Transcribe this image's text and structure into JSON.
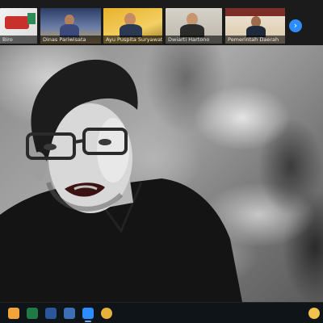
{
  "participants": [
    {
      "name": "Biro"
    },
    {
      "name": "Dinas Pariwisata"
    },
    {
      "name": "Ayu Puspita Suryawati"
    },
    {
      "name": "Dwiarti Hartono"
    },
    {
      "name": "Pemerintah Daerah"
    }
  ],
  "strip": {
    "next_glyph": "›"
  },
  "taskbar": {
    "icons": [
      {
        "name": "start-icon",
        "color": "#f2a33a"
      },
      {
        "name": "excel-icon",
        "color": "#1f7a44"
      },
      {
        "name": "word-icon",
        "color": "#2b579a"
      },
      {
        "name": "file-explorer-icon",
        "color": "#3d6fb6"
      },
      {
        "name": "zoom-icon",
        "color": "#2d8cff"
      },
      {
        "name": "chrome-icon",
        "color": "#e6b23a"
      },
      {
        "name": "tray-icon",
        "color": "#f2c14e"
      }
    ]
  },
  "colors": {
    "accent": "#2d8cff",
    "taskbar_bg": "#0e1418",
    "strip_bg": "#1b1b1b"
  }
}
